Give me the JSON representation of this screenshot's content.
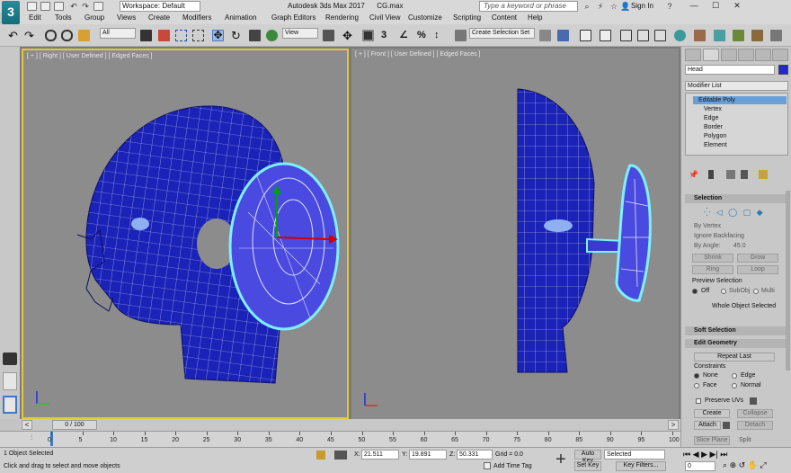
{
  "titlebar": {
    "workspace": "Workspace: Default",
    "app_title": "Autodesk 3ds Max 2017",
    "file_name": "CG.max",
    "search_placeholder": "Type a keyword or phrase",
    "sign_in": "Sign In"
  },
  "menu": [
    "Edit",
    "Tools",
    "Group",
    "Views",
    "Create",
    "Modifiers",
    "Animation",
    "Graph Editors",
    "Rendering",
    "Civil View",
    "Customize",
    "Scripting",
    "Content",
    "Help"
  ],
  "toolbar": {
    "selection_filter": "All",
    "ref_coord": "View",
    "named_selection": "Create Selection Set"
  },
  "viewports": {
    "left": {
      "label": "[ + ] [ Right ] [ User Defined ] [ Edged Faces ]"
    },
    "right": {
      "label": "[ + ] [ Front ] [ User Defined ] [ Edged Faces ]"
    }
  },
  "timeline": {
    "frame_indicator": "0 / 100",
    "ticks": [
      "0",
      "5",
      "10",
      "15",
      "20",
      "25",
      "30",
      "35",
      "40",
      "45",
      "50",
      "55",
      "60",
      "65",
      "70",
      "75",
      "80",
      "85",
      "90",
      "95",
      "100"
    ]
  },
  "status": {
    "selected_count": "1 Object Selected",
    "prompt": "Click and drag to select and move objects",
    "x_label": "X:",
    "x_value": "21.511",
    "y_label": "Y:",
    "y_value": "19.891",
    "z_label": "Z:",
    "z_value": "50.331",
    "grid": "Grid = 0.0",
    "add_time_tag": "Add Time Tag",
    "auto_key": "Auto Key",
    "set_key": "Set Key",
    "key_mode": "Selected",
    "key_filters": "Key Filters...",
    "current_frame": "0"
  },
  "command_panel": {
    "object_name": "Head",
    "object_color": "#1e2ad0",
    "modifier_list": "Modifier List",
    "stack_top": "Editable Poly",
    "stack_items": [
      "Vertex",
      "Edge",
      "Border",
      "Polygon",
      "Element"
    ],
    "selection": {
      "header": "Selection",
      "by_vertex": "By Vertex",
      "ignore_backfacing": "Ignore Backfacing",
      "by_angle": "By Angle:",
      "angle_value": "45.0",
      "shrink": "Shrink",
      "grow": "Grow",
      "ring": "Ring",
      "loop": "Loop",
      "preview_selection": "Preview Selection",
      "off": "Off",
      "subobj": "SubObj",
      "multi": "Multi",
      "whole_object": "Whole Object Selected"
    },
    "soft_selection": "Soft Selection",
    "edit_geometry": {
      "header": "Edit Geometry",
      "repeat_last": "Repeat Last",
      "constraints": "Constraints",
      "none": "None",
      "edge": "Edge",
      "face": "Face",
      "normal": "Normal",
      "preserve_uvs": "Preserve UVs",
      "create": "Create",
      "collapse": "Collapse",
      "attach": "Attach",
      "detach": "Detach",
      "slice_plane": "Slice Plane",
      "split": "Split"
    }
  }
}
